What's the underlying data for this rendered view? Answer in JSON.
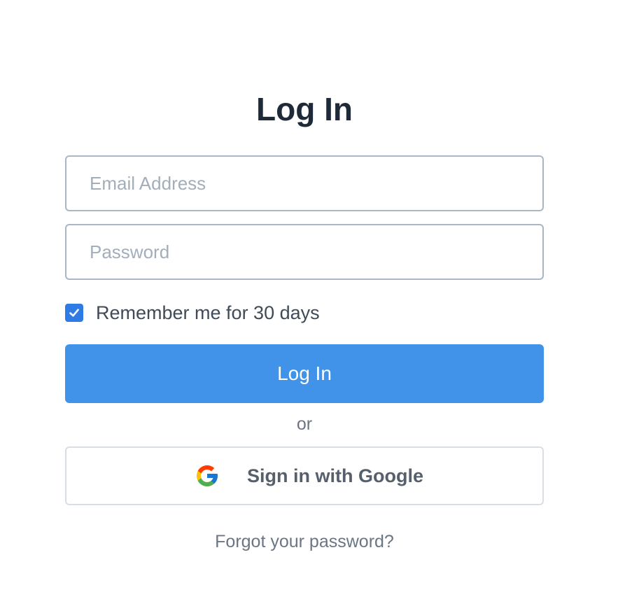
{
  "title": "Log In",
  "form": {
    "email": {
      "placeholder": "Email Address",
      "value": ""
    },
    "password": {
      "placeholder": "Password",
      "value": ""
    },
    "remember": {
      "label": "Remember me for 30 days",
      "checked": true
    },
    "submit_label": "Log In",
    "divider_text": "or",
    "google": {
      "label": "Sign in with Google",
      "icon": "google-logo-icon"
    },
    "forgot_label": "Forgot your password?"
  },
  "colors": {
    "primary": "#4093e8",
    "checkbox": "#2f7be6",
    "title": "#1e2a38",
    "muted": "#6b7684",
    "input_border": "#a9b6c4",
    "google_border": "#d9dee4"
  }
}
